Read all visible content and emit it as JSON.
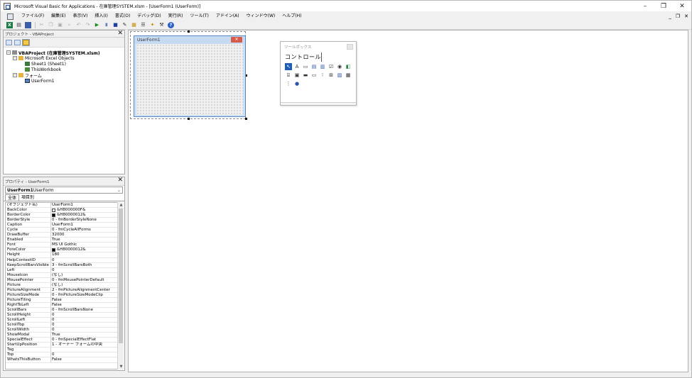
{
  "window": {
    "title": "Microsoft Visual Basic for Applications - 在庫管理SYSTEM.xlsm - [UserForm1 (UserForm)]",
    "minimize": "–",
    "restore": "❐",
    "close": "✕"
  },
  "menu": {
    "items": [
      "ファイル(F)",
      "編集(E)",
      "表示(V)",
      "挿入(I)",
      "書式(O)",
      "デバッグ(D)",
      "実行(R)",
      "ツール(T)",
      "アドイン(A)",
      "ウィンドウ(W)",
      "ヘルプ(H)"
    ],
    "mdi_minimize": "_",
    "mdi_restore": "❐",
    "mdi_close": "✕"
  },
  "project_panel": {
    "title": "プロジェクト - VBAProject",
    "close": "✕",
    "tree": {
      "root": "VBAProject (在庫管理SYSTEM.xlsm)",
      "excel_objects": "Microsoft Excel Objects",
      "sheet1": "Sheet1 (Sheet1)",
      "thisworkbook": "ThisWorkbook",
      "forms": "フォーム",
      "userform1": "UserForm1"
    }
  },
  "properties_panel": {
    "title": "プロパティ - UserForm1",
    "close": "✕",
    "object_name": "UserForm1",
    "object_type": " UserForm",
    "tab_all": "全体",
    "tab_category": "項目別",
    "rows": [
      {
        "name": "(オブジェクト名)",
        "value": "UserForm1"
      },
      {
        "name": "BackColor",
        "value": "&H8000000F&",
        "swatch": "#f0f0f0"
      },
      {
        "name": "BorderColor",
        "value": "&H80000012&",
        "swatch": "#000000"
      },
      {
        "name": "BorderStyle",
        "value": "0 - fmBorderStyleNone"
      },
      {
        "name": "Caption",
        "value": "UserForm1"
      },
      {
        "name": "Cycle",
        "value": "0 - fmCycleAllForms"
      },
      {
        "name": "DrawBuffer",
        "value": "32000"
      },
      {
        "name": "Enabled",
        "value": "True"
      },
      {
        "name": "Font",
        "value": "MS UI Gothic"
      },
      {
        "name": "ForeColor",
        "value": "&H80000012&",
        "swatch": "#000000"
      },
      {
        "name": "Height",
        "value": "180"
      },
      {
        "name": "HelpContextID",
        "value": "0"
      },
      {
        "name": "KeepScrollBarsVisible",
        "value": "3 - fmScrollBarsBoth"
      },
      {
        "name": "Left",
        "value": "0"
      },
      {
        "name": "MouseIcon",
        "value": "(なし)"
      },
      {
        "name": "MousePointer",
        "value": "0 - fmMousePointerDefault"
      },
      {
        "name": "Picture",
        "value": "(なし)"
      },
      {
        "name": "PictureAlignment",
        "value": "2 - fmPictureAlignmentCenter"
      },
      {
        "name": "PictureSizeMode",
        "value": "0 - fmPictureSizeModeClip"
      },
      {
        "name": "PictureTiling",
        "value": "False"
      },
      {
        "name": "RightToLeft",
        "value": "False"
      },
      {
        "name": "ScrollBars",
        "value": "0 - fmScrollBarsNone"
      },
      {
        "name": "ScrollHeight",
        "value": "0"
      },
      {
        "name": "ScrollLeft",
        "value": "0"
      },
      {
        "name": "ScrollTop",
        "value": "0"
      },
      {
        "name": "ScrollWidth",
        "value": "0"
      },
      {
        "name": "ShowModal",
        "value": "True"
      },
      {
        "name": "SpecialEffect",
        "value": "0 - fmSpecialEffectFlat"
      },
      {
        "name": "StartUpPosition",
        "value": "1 - オーナー フォームの中央"
      },
      {
        "name": "Tag",
        "value": ""
      },
      {
        "name": "Top",
        "value": "0"
      },
      {
        "name": "WhatsThisButton",
        "value": "False"
      }
    ]
  },
  "userform": {
    "caption": "UserForm1",
    "close": "✕"
  },
  "toolbox": {
    "title": "ツールボックス",
    "tab": "コントロール"
  }
}
